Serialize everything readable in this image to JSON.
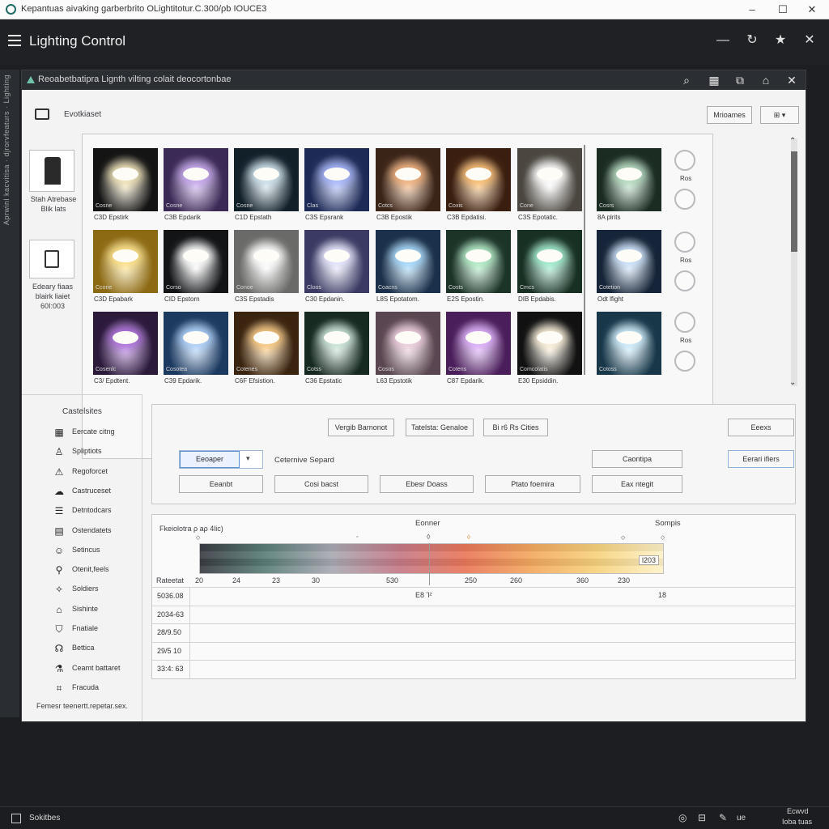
{
  "window": {
    "title": "Kepantuas aivaking garberbrito OLightitotur.C.300/ρb IOUCE3",
    "controls": [
      "–",
      "☐",
      "✕"
    ]
  },
  "app": {
    "title": "Lighting Control",
    "header_icons": [
      "minimize-icon",
      "refresh-icon",
      "star-icon",
      "close-icon"
    ]
  },
  "left_rail": {
    "text": "Aprwinl kacvitisa ·  djrorvfeaturs ·  Lighting"
  },
  "panel": {
    "breadcrumb": "Reoabetbatipra Lignth vilting colait deocortonbae",
    "section_title": "Evotkiaset",
    "top_buttons": {
      "primary": "Mrioames",
      "dropdown": "⊞"
    }
  },
  "presets": [
    {
      "label": "Stah Atrebase\nBlik lats"
    },
    {
      "label": "Edeary fiaas\nblairk liaiet\n60I:003"
    }
  ],
  "tiles": [
    {
      "name": "Cosne",
      "caption": "C3D Epstirk",
      "bg": "#141414",
      "glow": "#f4e7b9",
      "row": 0
    },
    {
      "name": "Cosne",
      "caption": "C3B Epdarik",
      "bg": "#3b2a56",
      "glow": "#c8a8f0",
      "row": 0
    },
    {
      "name": "Cosne",
      "caption": "C1D Epstath",
      "bg": "#12202a",
      "glow": "#cfe4ee",
      "row": 0
    },
    {
      "name": "Clas",
      "caption": "C3S Epsrank",
      "bg": "#1e2a56",
      "glow": "#a8b8ff",
      "row": 0
    },
    {
      "name": "Cotcs",
      "caption": "C3B Epostik",
      "bg": "#3a2418",
      "glow": "#f6b27a",
      "row": 0
    },
    {
      "name": "Coxis",
      "caption": "C3B Epdatisi.",
      "bg": "#3a1e10",
      "glow": "#ffc070",
      "row": 0
    },
    {
      "name": "Cone",
      "caption": "C3S Epotatic.",
      "bg": "#4b4740",
      "glow": "#ffffff",
      "row": 0
    },
    {
      "name": "Cosrs",
      "caption": "8A plrits",
      "bg": "#1b2c22",
      "glow": "#b8e0c4",
      "row": 0
    },
    {
      "name": "Ccorie",
      "caption": "C3D Epabark",
      "bg": "#8c6a14",
      "glow": "#ffe48a",
      "row": 1
    },
    {
      "name": "Corso",
      "caption": "CID Epstorn",
      "bg": "#121416",
      "glow": "#ffffff",
      "row": 1
    },
    {
      "name": "Conoe",
      "caption": "C3S Epstadis",
      "bg": "#6a6a68",
      "glow": "#ffffff",
      "row": 1
    },
    {
      "name": "Cloos",
      "caption": "C30 Epdanin.",
      "bg": "#3a3a64",
      "glow": "#e8e8ff",
      "row": 1
    },
    {
      "name": "Coacns",
      "caption": "L8S Epotatom.",
      "bg": "#1b304a",
      "glow": "#a6dcff",
      "row": 1
    },
    {
      "name": "Costs",
      "caption": "E2S Epostin.",
      "bg": "#1c3428",
      "glow": "#b2f0c8",
      "row": 1
    },
    {
      "name": "Cmcs",
      "caption": "DIB Epdabis.",
      "bg": "#183024",
      "glow": "#9ff0d0",
      "row": 1
    },
    {
      "name": "Cotetion",
      "caption": "Odt lfight",
      "bg": "#152438",
      "glow": "#cfe6ff",
      "row": 1
    },
    {
      "name": "Cosenlc",
      "caption": "C3/ Epdtent.",
      "bg": "#2b1a3a",
      "glow": "#b070e0",
      "row": 2
    },
    {
      "name": "Cosotea",
      "caption": "C39 Epdarik.",
      "bg": "#1c3a60",
      "glow": "#b0d4ff",
      "row": 2
    },
    {
      "name": "Cotenes",
      "caption": "C6F Efsistion.",
      "bg": "#3a2410",
      "glow": "#ffcc80",
      "row": 2
    },
    {
      "name": "Cotss",
      "caption": "C36 Epstatic",
      "bg": "#162a22",
      "glow": "#cfe9dc",
      "row": 2
    },
    {
      "name": "Cosos",
      "caption": "L63 Epstotik",
      "bg": "#5a4650",
      "glow": "#f0d0e0",
      "row": 2
    },
    {
      "name": "Cotens",
      "caption": "C87 Epdarik.",
      "bg": "#4a1e5a",
      "glow": "#e0b0ff",
      "row": 2
    },
    {
      "name": "Comcolatis",
      "caption": "E30 Epsiddin.",
      "bg": "#111111",
      "glow": "#fff4dc",
      "row": 2
    },
    {
      "name": "Cotoss",
      "caption": "",
      "bg": "#18384a",
      "glow": "#d0f0ff",
      "row": 2
    }
  ],
  "radios": [
    {
      "label": "Ros"
    },
    {
      "label": "Ros"
    },
    {
      "label": "Ros"
    }
  ],
  "sidebar": {
    "heading": "Castelsites",
    "items": [
      {
        "icon": "grid-icon",
        "glyph": "▦",
        "label": "Eercate citng"
      },
      {
        "icon": "person-icon",
        "glyph": "♙",
        "label": "Spliptiots"
      },
      {
        "icon": "warning-icon",
        "glyph": "⚠",
        "label": "Regoforcet"
      },
      {
        "icon": "cloud-icon",
        "glyph": "☁",
        "label": "Castruceset"
      },
      {
        "icon": "list-icon",
        "glyph": "☰",
        "label": "Detntodcars"
      },
      {
        "icon": "table-icon",
        "glyph": "▤",
        "label": "Ostendatets"
      },
      {
        "icon": "user-icon",
        "glyph": "☺",
        "label": "Setincus"
      },
      {
        "icon": "pin-icon",
        "glyph": "⚲",
        "label": "Otenit,feels"
      },
      {
        "icon": "wand-icon",
        "glyph": "✧",
        "label": "Soldiers"
      },
      {
        "icon": "bag-icon",
        "glyph": "⌂",
        "label": "Sishinte"
      },
      {
        "icon": "lamp-icon",
        "glyph": "⛉",
        "label": "Fnatiale"
      },
      {
        "icon": "headset-icon",
        "glyph": "☊",
        "label": "Bettica"
      },
      {
        "icon": "flask-icon",
        "glyph": "⚗",
        "label": "Ceamt battaret"
      },
      {
        "icon": "camera-icon",
        "glyph": "⌗",
        "label": "Fracuda"
      }
    ],
    "footer": "Femesr teenertt.repetar.sex."
  },
  "controls": {
    "row1": [
      "Vergib Barnonot",
      "Tatelsta: Genaloe",
      "Bi r6 Rs Cities",
      "Eeexs"
    ],
    "select_value": "Eeoaper",
    "select_label": "Ceternive Separd",
    "row2_right": [
      "Caontipa",
      "Eerari ifiers"
    ],
    "row3": [
      "Eeanbt",
      "Cosi bacst",
      "Ebesr Doass",
      "Ptato foemira",
      "Eax ntegit"
    ]
  },
  "gradient": {
    "title": "Fkeiolotra ρ aρ 4lic)",
    "center_label": "Eonner",
    "right_label": "Sompis",
    "value_box": "l203",
    "tick_labels": [
      "20",
      "24",
      "23",
      "30",
      "530",
      "250",
      "260",
      "360",
      "230"
    ],
    "left_label": "Rateetat",
    "stops": [
      "#3a3d44",
      "#5b7f7a",
      "#a9a9b2",
      "#c47a88",
      "#e9775a",
      "#f2a860",
      "#f6d27e",
      "#fff2c8"
    ]
  },
  "table": {
    "header_mid": "E8 ʼl²",
    "header_right": "18",
    "rows": [
      "5036.08",
      "2034-63",
      "28/9.50",
      "29/5 10",
      "33:4: 63"
    ]
  },
  "statusbar": {
    "left": "Sokitbes",
    "right_top": "Ecwvd",
    "right_bottom": "Ioba tuas",
    "mid": "ue"
  }
}
